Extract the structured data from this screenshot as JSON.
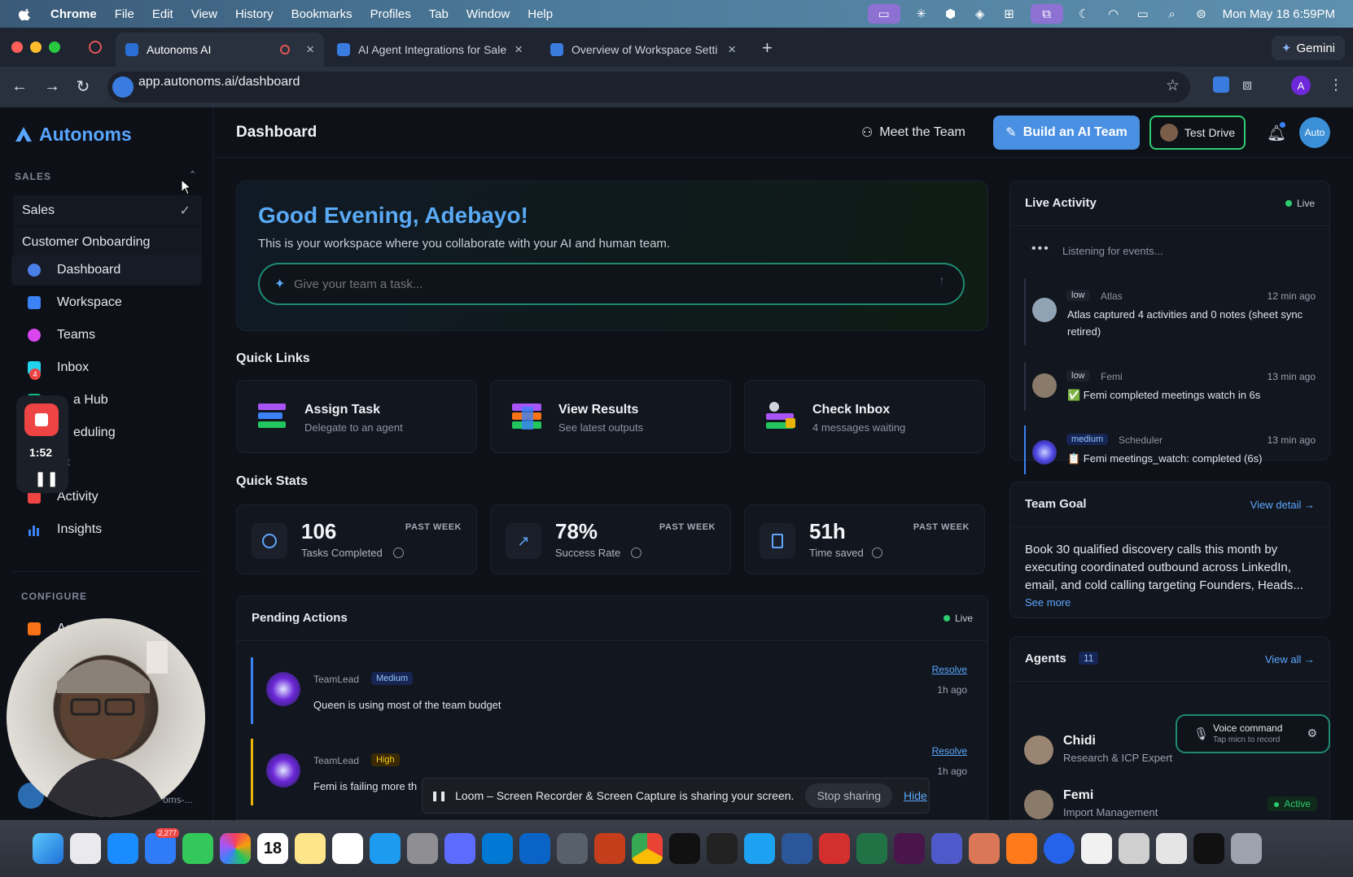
{
  "menubar": {
    "app": "Chrome",
    "items": [
      "File",
      "Edit",
      "View",
      "History",
      "Bookmarks",
      "Profiles",
      "Tab",
      "Window",
      "Help"
    ],
    "clock": "Mon May 18  6:59PM"
  },
  "browser": {
    "tabs": [
      {
        "title": "Autonoms AI"
      },
      {
        "title": "AI Agent Integrations for Sale"
      },
      {
        "title": "Overview of Workspace Setti"
      }
    ],
    "gemini_label": "Gemini",
    "url": "app.autonoms.ai/dashboard",
    "profile_initial": "A"
  },
  "sidebar": {
    "brand": "Autonoms",
    "workspace_section": "SALES",
    "workspaces": [
      {
        "label": "Sales"
      },
      {
        "label": "Customer Onboarding"
      }
    ],
    "nav": [
      {
        "label": "Dashboard"
      },
      {
        "label": "Workspace"
      },
      {
        "label": "Teams"
      },
      {
        "label": "Inbox"
      },
      {
        "label": "a Hub"
      },
      {
        "label": "eduling"
      },
      {
        "label": "t"
      },
      {
        "label": "Activity"
      },
      {
        "label": "Insights"
      }
    ],
    "inbox_badge": "4",
    "configure_section": "CONFIGURE",
    "configure_item": "Agent S",
    "footer_user": "oms-..."
  },
  "recorder": {
    "timer": "1:52"
  },
  "header": {
    "title": "Dashboard",
    "meet_team": "Meet the Team",
    "build_team": "Build an AI Team",
    "test_drive": "Test Drive",
    "avatar_text": "Auto"
  },
  "hero": {
    "greeting": "Good Evening, Adebayo!",
    "subtitle": "This is your workspace where you collaborate with your AI and human team.",
    "task_placeholder": "Give your team a task..."
  },
  "quick_links": {
    "title": "Quick Links",
    "items": [
      {
        "name": "Assign Task",
        "sub": "Delegate to an agent"
      },
      {
        "name": "View Results",
        "sub": "See latest outputs"
      },
      {
        "name": "Check Inbox",
        "sub": "4 messages waiting"
      }
    ]
  },
  "quick_stats": {
    "title": "Quick Stats",
    "items": [
      {
        "value": "106",
        "label": "Tasks Completed",
        "period": "PAST WEEK"
      },
      {
        "value": "78%",
        "label": "Success Rate",
        "period": "PAST WEEK"
      },
      {
        "value": "51h",
        "label": "Time saved",
        "period": "PAST WEEK"
      }
    ]
  },
  "pending": {
    "title": "Pending Actions",
    "live": "Live",
    "items": [
      {
        "who": "TeamLead",
        "priority": "Medium",
        "message": "Queen is using most of the team budget",
        "action": "Resolve",
        "time": "1h ago",
        "color": "#3b82f6"
      },
      {
        "who": "TeamLead",
        "priority": "High",
        "message": "Femi is failing more th",
        "action": "Resolve",
        "time": "1h ago",
        "color": "#eab308"
      }
    ]
  },
  "loom": {
    "text": "Loom – Screen Recorder & Screen Capture is sharing your screen.",
    "stop": "Stop sharing",
    "hide": "Hide"
  },
  "live_activity": {
    "title": "Live Activity",
    "live": "Live",
    "listening": "Listening for events...",
    "items": [
      {
        "level": "low",
        "who": "Atlas",
        "time": "12 min ago",
        "text": "Atlas captured 4 activities and 0 notes (sheet sync retired)"
      },
      {
        "level": "low",
        "who": "Femi",
        "time": "13 min ago",
        "text": "✅ Femi completed meetings watch in 6s"
      },
      {
        "level": "medium",
        "who": "Scheduler",
        "time": "13 min ago",
        "text": "📋 Femi meetings_watch: completed (6s)"
      }
    ]
  },
  "team_goal": {
    "title": "Team Goal",
    "link": "View detail →",
    "text": "Book 30 qualified discovery calls this month by executing coordinated outbound across LinkedIn, email, and cold calling targeting Founders, Heads...",
    "more": "See more"
  },
  "agents": {
    "title": "Agents",
    "count": "11",
    "link": "View all →",
    "items": [
      {
        "name": "Chidi",
        "role": "Research & ICP Expert"
      },
      {
        "name": "Femi",
        "role": "Import Management",
        "status": "Active"
      }
    ]
  },
  "voice": {
    "title": "Voice command",
    "sub": "Tap micn to record"
  },
  "dock": {
    "calendar_day": "18",
    "mail_badge": "2,277"
  },
  "colors": {
    "accent": "#58a6ff",
    "primary_button": "#3b82f6",
    "live_green": "#2ecc71"
  }
}
